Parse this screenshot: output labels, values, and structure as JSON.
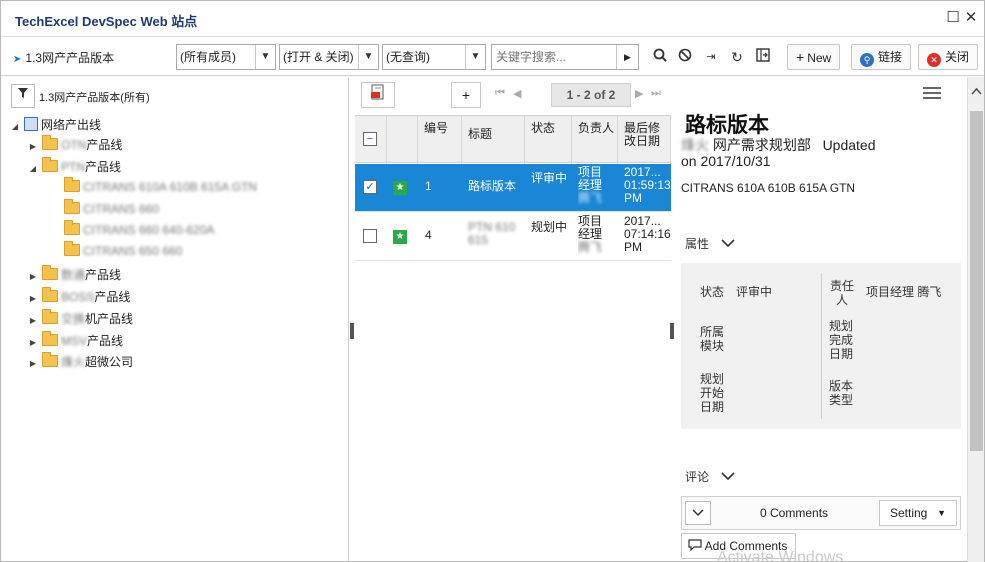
{
  "window": {
    "title": "TechExcel DevSpec Web 站点"
  },
  "toolbar": {
    "breadcrumb": "1.3网产产品版本",
    "members_select": "(所有成员)",
    "status_select": "(打开 & 关闭)",
    "query_select": "(无查询)",
    "search_placeholder": "关键字搜索...",
    "new_label": "New",
    "link_label": "链接",
    "close_label": "关闭"
  },
  "left": {
    "filter_text": "1.3网产产品版本(所有)",
    "tree": {
      "root": "网络产出线",
      "items": [
        {
          "label": "产品线",
          "blurred_prefix": "OTN"
        },
        {
          "label": "产品线",
          "blurred_prefix": "PTN"
        },
        {
          "label": "CITRANS 610A 610B 615A GTN",
          "blurred": true
        },
        {
          "label": "CITRANS 660",
          "blurred": true
        },
        {
          "label": "CITRANS 660 640-620A",
          "blurred": true
        },
        {
          "label": "CITRANS 650 660",
          "blurred": true
        },
        {
          "label": "产品线",
          "blurred_prefix": "数通"
        },
        {
          "label": "产品线",
          "blurred_prefix": "BOSS"
        },
        {
          "label": "机产品线",
          "blurred_prefix": "交换"
        },
        {
          "label": "产品线",
          "blurred_prefix": "MSV"
        },
        {
          "label": "超微公司",
          "blurred_prefix": "烽火"
        }
      ]
    }
  },
  "middle": {
    "pager": "1 - 2 of 2",
    "headers": [
      "编号",
      "标题",
      "状态",
      "负责人",
      "最后修改日期"
    ],
    "rows": [
      {
        "id": "1",
        "title": "路标版本",
        "status": "评审中",
        "owner": "项目经理",
        "owner_blur": "腾飞",
        "date": "2017...",
        "time": "01:59:13",
        "ampm": "PM",
        "selected": true
      },
      {
        "id": "4",
        "title": "PTN 610 615",
        "status": "规划中",
        "owner": "项目经理",
        "owner_blur": "腾飞",
        "date": "2017...",
        "time": "07:14:16",
        "ampm": "PM",
        "selected": false
      }
    ]
  },
  "detail": {
    "title": "路标版本",
    "meta_blur": "烽火",
    "meta_dept": "网产需求规划部",
    "meta_updated": "Updated",
    "meta_on": "on  2017/10/31",
    "description": "CITRANS 610A 610B 615A GTN",
    "attr_section": "属性",
    "props": {
      "status_label": "状态",
      "status_value": "评审中",
      "owner_label": "责任人",
      "owner_value": "项目经理 腾飞",
      "module_label": "所属模块",
      "plan_done_label": "规划完成日期",
      "plan_start_label": "规划开始日期",
      "version_type_label": "版本类型"
    },
    "comments_section": "评论",
    "comments_count": "0 Comments",
    "setting_label": "Setting",
    "add_comments_label": "Add Comments"
  },
  "watermark": "Activate Windows",
  "colors": {
    "selected_row": "#1a86d6",
    "title_text": "#1f3a6b",
    "star_green": "#2ba84a",
    "folder": "#f3c34d"
  }
}
